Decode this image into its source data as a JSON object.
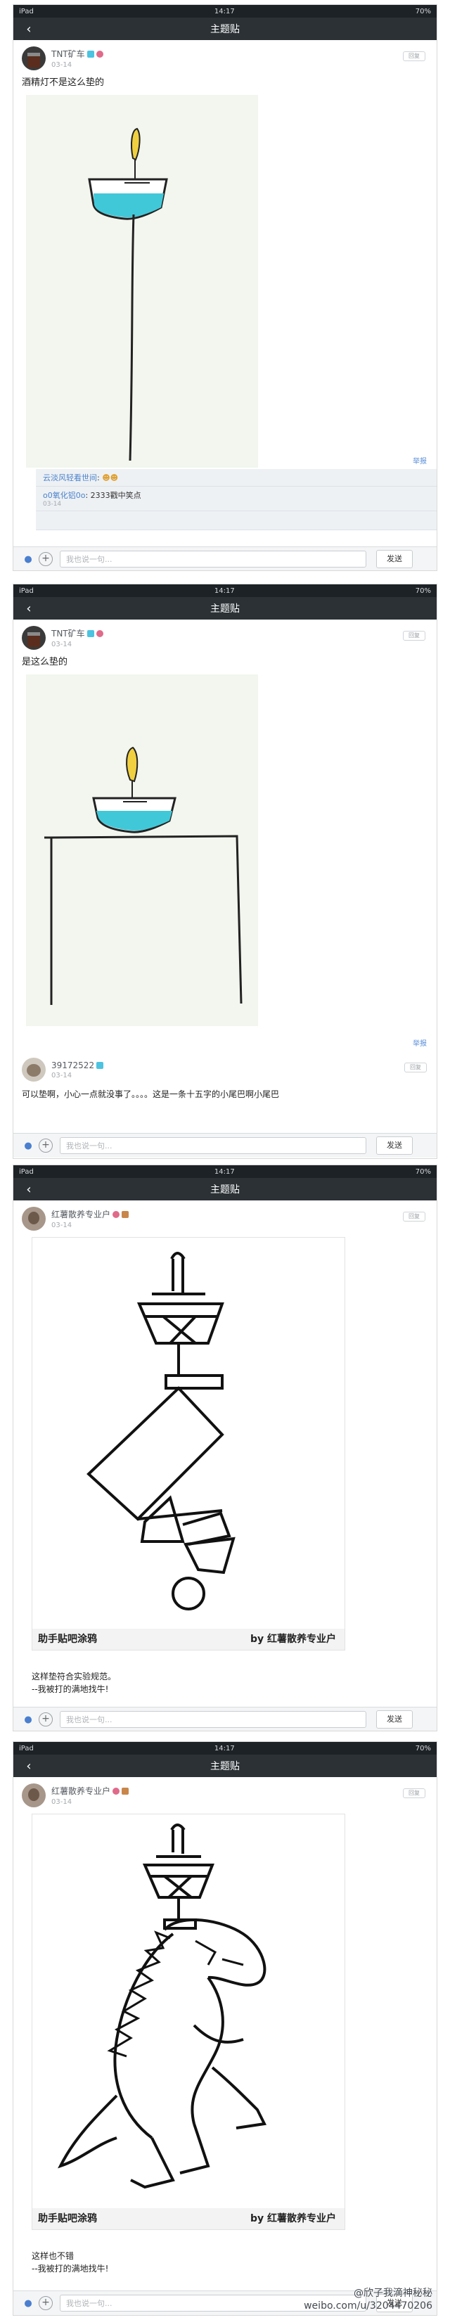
{
  "status": {
    "left": "iPad",
    "time": "14:17",
    "battery": "70%"
  },
  "title": "主题贴",
  "screen1": {
    "post": {
      "user": "TNT矿车",
      "time": "03-14",
      "text": "酒精灯不是这么垫的",
      "report": "举报"
    },
    "comments": [
      {
        "user": "云淡风轻看世间",
        "text": ": ",
        "time": ""
      },
      {
        "user": "o0氧化铝0o",
        "text": ": 2333戳中笑点",
        "time": "03-14"
      }
    ],
    "input": {
      "placeholder": "我也说一句...",
      "send": "发送"
    }
  },
  "screen2": {
    "post": {
      "user": "TNT矿车",
      "time": "03-14",
      "text": "是这么垫的",
      "report": "举报"
    },
    "post2": {
      "user": "39172522",
      "time": "03-14",
      "text": "可以垫啊，小心一点就没事了。。。。这是一条十五字的小尾巴啊小尾巴"
    },
    "input": {
      "placeholder": "我也说一句...",
      "send": "发送"
    }
  },
  "screen3": {
    "post": {
      "user": "红薯散养专业户",
      "time": "03-14"
    },
    "img_footer_left": "助手贴吧涂鸦",
    "img_footer_right": "by 红薯散养专业户",
    "text1": "这样垫符合实验规范。",
    "text2": "--我被打的满地找牛!",
    "input": {
      "placeholder": "我也说一句...",
      "send": "发送"
    }
  },
  "screen4": {
    "post": {
      "user": "红薯散养专业户",
      "time": "03-14"
    },
    "img_footer_left": "助手贴吧涂鸦",
    "img_footer_right": "by 红薯散养专业户",
    "text1": "这样也不错",
    "text2": "--我被打的满地找牛!",
    "input": {
      "placeholder": "我也说一句...",
      "send": "发送"
    }
  },
  "reply_label": "回复",
  "watermark": {
    "line1": "@欣子我滴神秘秘",
    "line2": "weibo.com/u/3204470206"
  },
  "colors": {
    "statusbar": "#1d2226",
    "titlebar": "#2b3135",
    "link": "#4a82cc",
    "water": "#41c8d8",
    "flame": "#f0d040"
  }
}
